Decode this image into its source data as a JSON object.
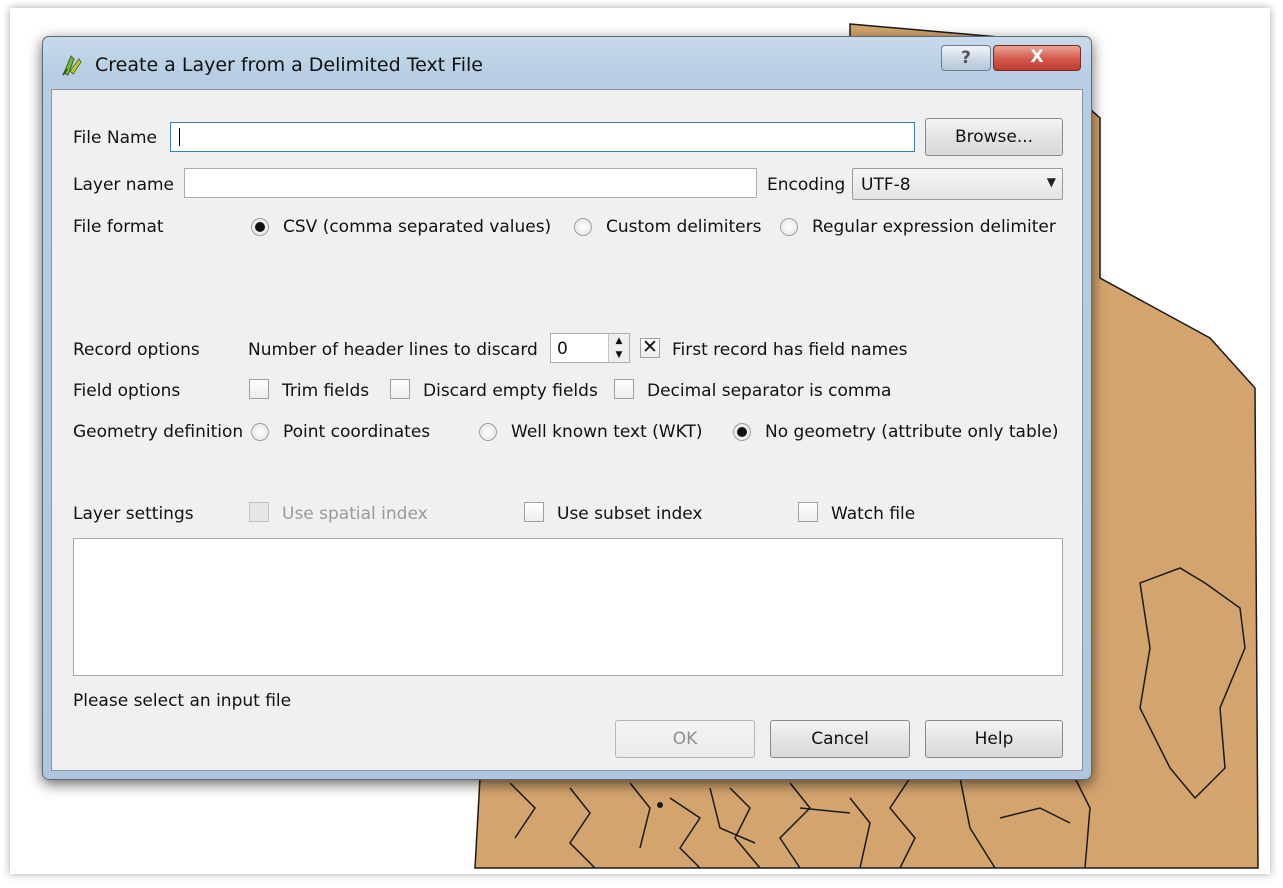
{
  "window": {
    "title": "Create a Layer from a Delimited Text File",
    "help_glyph": "?",
    "close_glyph": "X"
  },
  "file": {
    "label": "File Name",
    "value": "",
    "browse_label": "Browse..."
  },
  "layer": {
    "label": "Layer name",
    "value": ""
  },
  "encoding": {
    "label": "Encoding",
    "selected": "UTF-8"
  },
  "file_format": {
    "label": "File format",
    "options": [
      {
        "label": "CSV (comma separated values)",
        "selected": true
      },
      {
        "label": "Custom delimiters",
        "selected": false
      },
      {
        "label": "Regular expression delimiter",
        "selected": false
      }
    ]
  },
  "record_options": {
    "label": "Record options",
    "header_lines_label": "Number of header lines to discard",
    "header_lines_value": "0",
    "first_record_label": "First record has field names",
    "first_record_checked": true
  },
  "field_options": {
    "label": "Field options",
    "trim_label": "Trim fields",
    "discard_label": "Discard empty fields",
    "decimal_label": "Decimal separator is comma"
  },
  "geometry": {
    "label": "Geometry definition",
    "options": [
      {
        "label": "Point coordinates",
        "selected": false
      },
      {
        "label": "Well known text (WKT)",
        "selected": false
      },
      {
        "label": "No geometry (attribute only table)",
        "selected": true
      }
    ]
  },
  "layer_settings": {
    "label": "Layer settings",
    "spatial_index_label": "Use spatial index",
    "subset_index_label": "Use subset index",
    "watch_file_label": "Watch file"
  },
  "status": "Please select an input file",
  "buttons": {
    "ok": "OK",
    "cancel": "Cancel",
    "help": "Help"
  },
  "colors": {
    "map_fill": "#d4a46e",
    "map_border": "#1a1a1a",
    "title_bar": "#b7cde3",
    "close_button": "#c7473a"
  }
}
